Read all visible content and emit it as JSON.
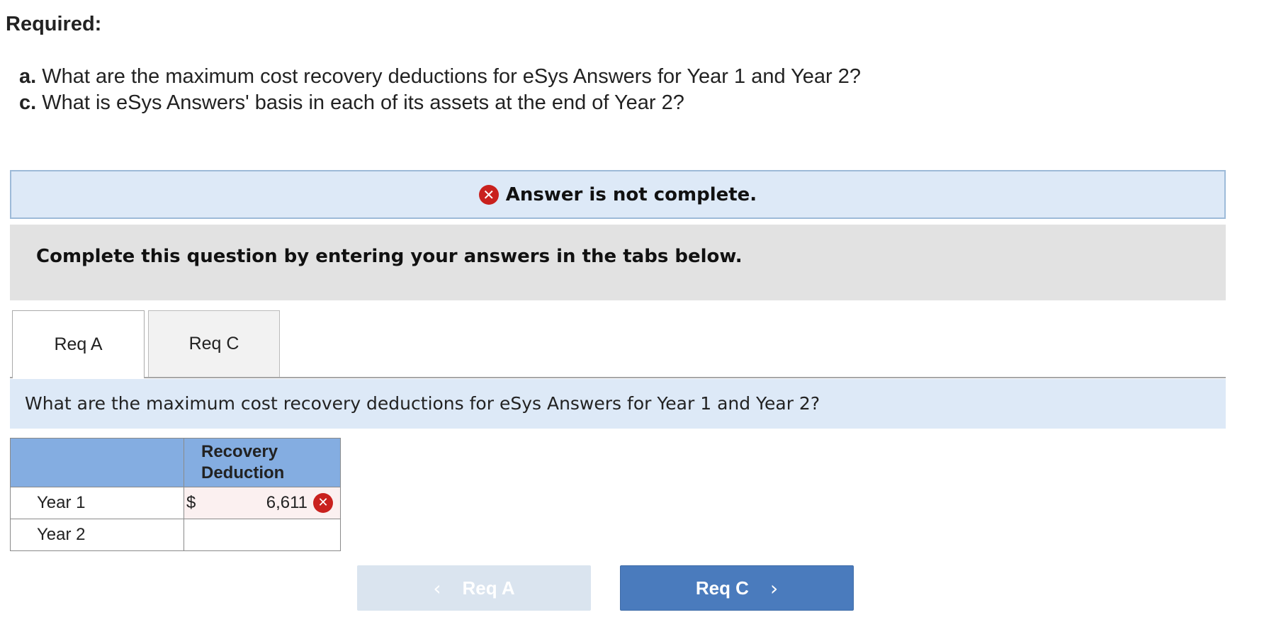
{
  "header": {
    "required_label": "Required:",
    "questions": [
      {
        "tag": "a.",
        "text": "What are the maximum cost recovery deductions for eSys Answers for Year 1 and Year 2?"
      },
      {
        "tag": "c.",
        "text": "What is eSys Answers' basis in each of its assets at the end of Year 2?"
      }
    ]
  },
  "answer_status": {
    "text": "Answer is not complete.",
    "icon": "x-circle-icon",
    "color": "#c9211e"
  },
  "instruction": "Complete this question by entering your answers in the tabs below.",
  "tabs": [
    {
      "label": "Req A",
      "active": true
    },
    {
      "label": "Req C",
      "active": false
    }
  ],
  "question": "What are the maximum cost recovery deductions for eSys Answers for Year 1 and Year 2?",
  "table": {
    "column_header": "Recovery Deduction",
    "rows": [
      {
        "label": "Year 1",
        "currency": "$",
        "value": "6,611",
        "status": "incorrect"
      },
      {
        "label": "Year 2",
        "currency": "",
        "value": "",
        "status": ""
      }
    ]
  },
  "navigation": {
    "prev_label": "Req A",
    "next_label": "Req C",
    "prev_icon": "chevron-left-icon",
    "next_icon": "chevron-right-icon",
    "accent": "#4a7bbd"
  }
}
